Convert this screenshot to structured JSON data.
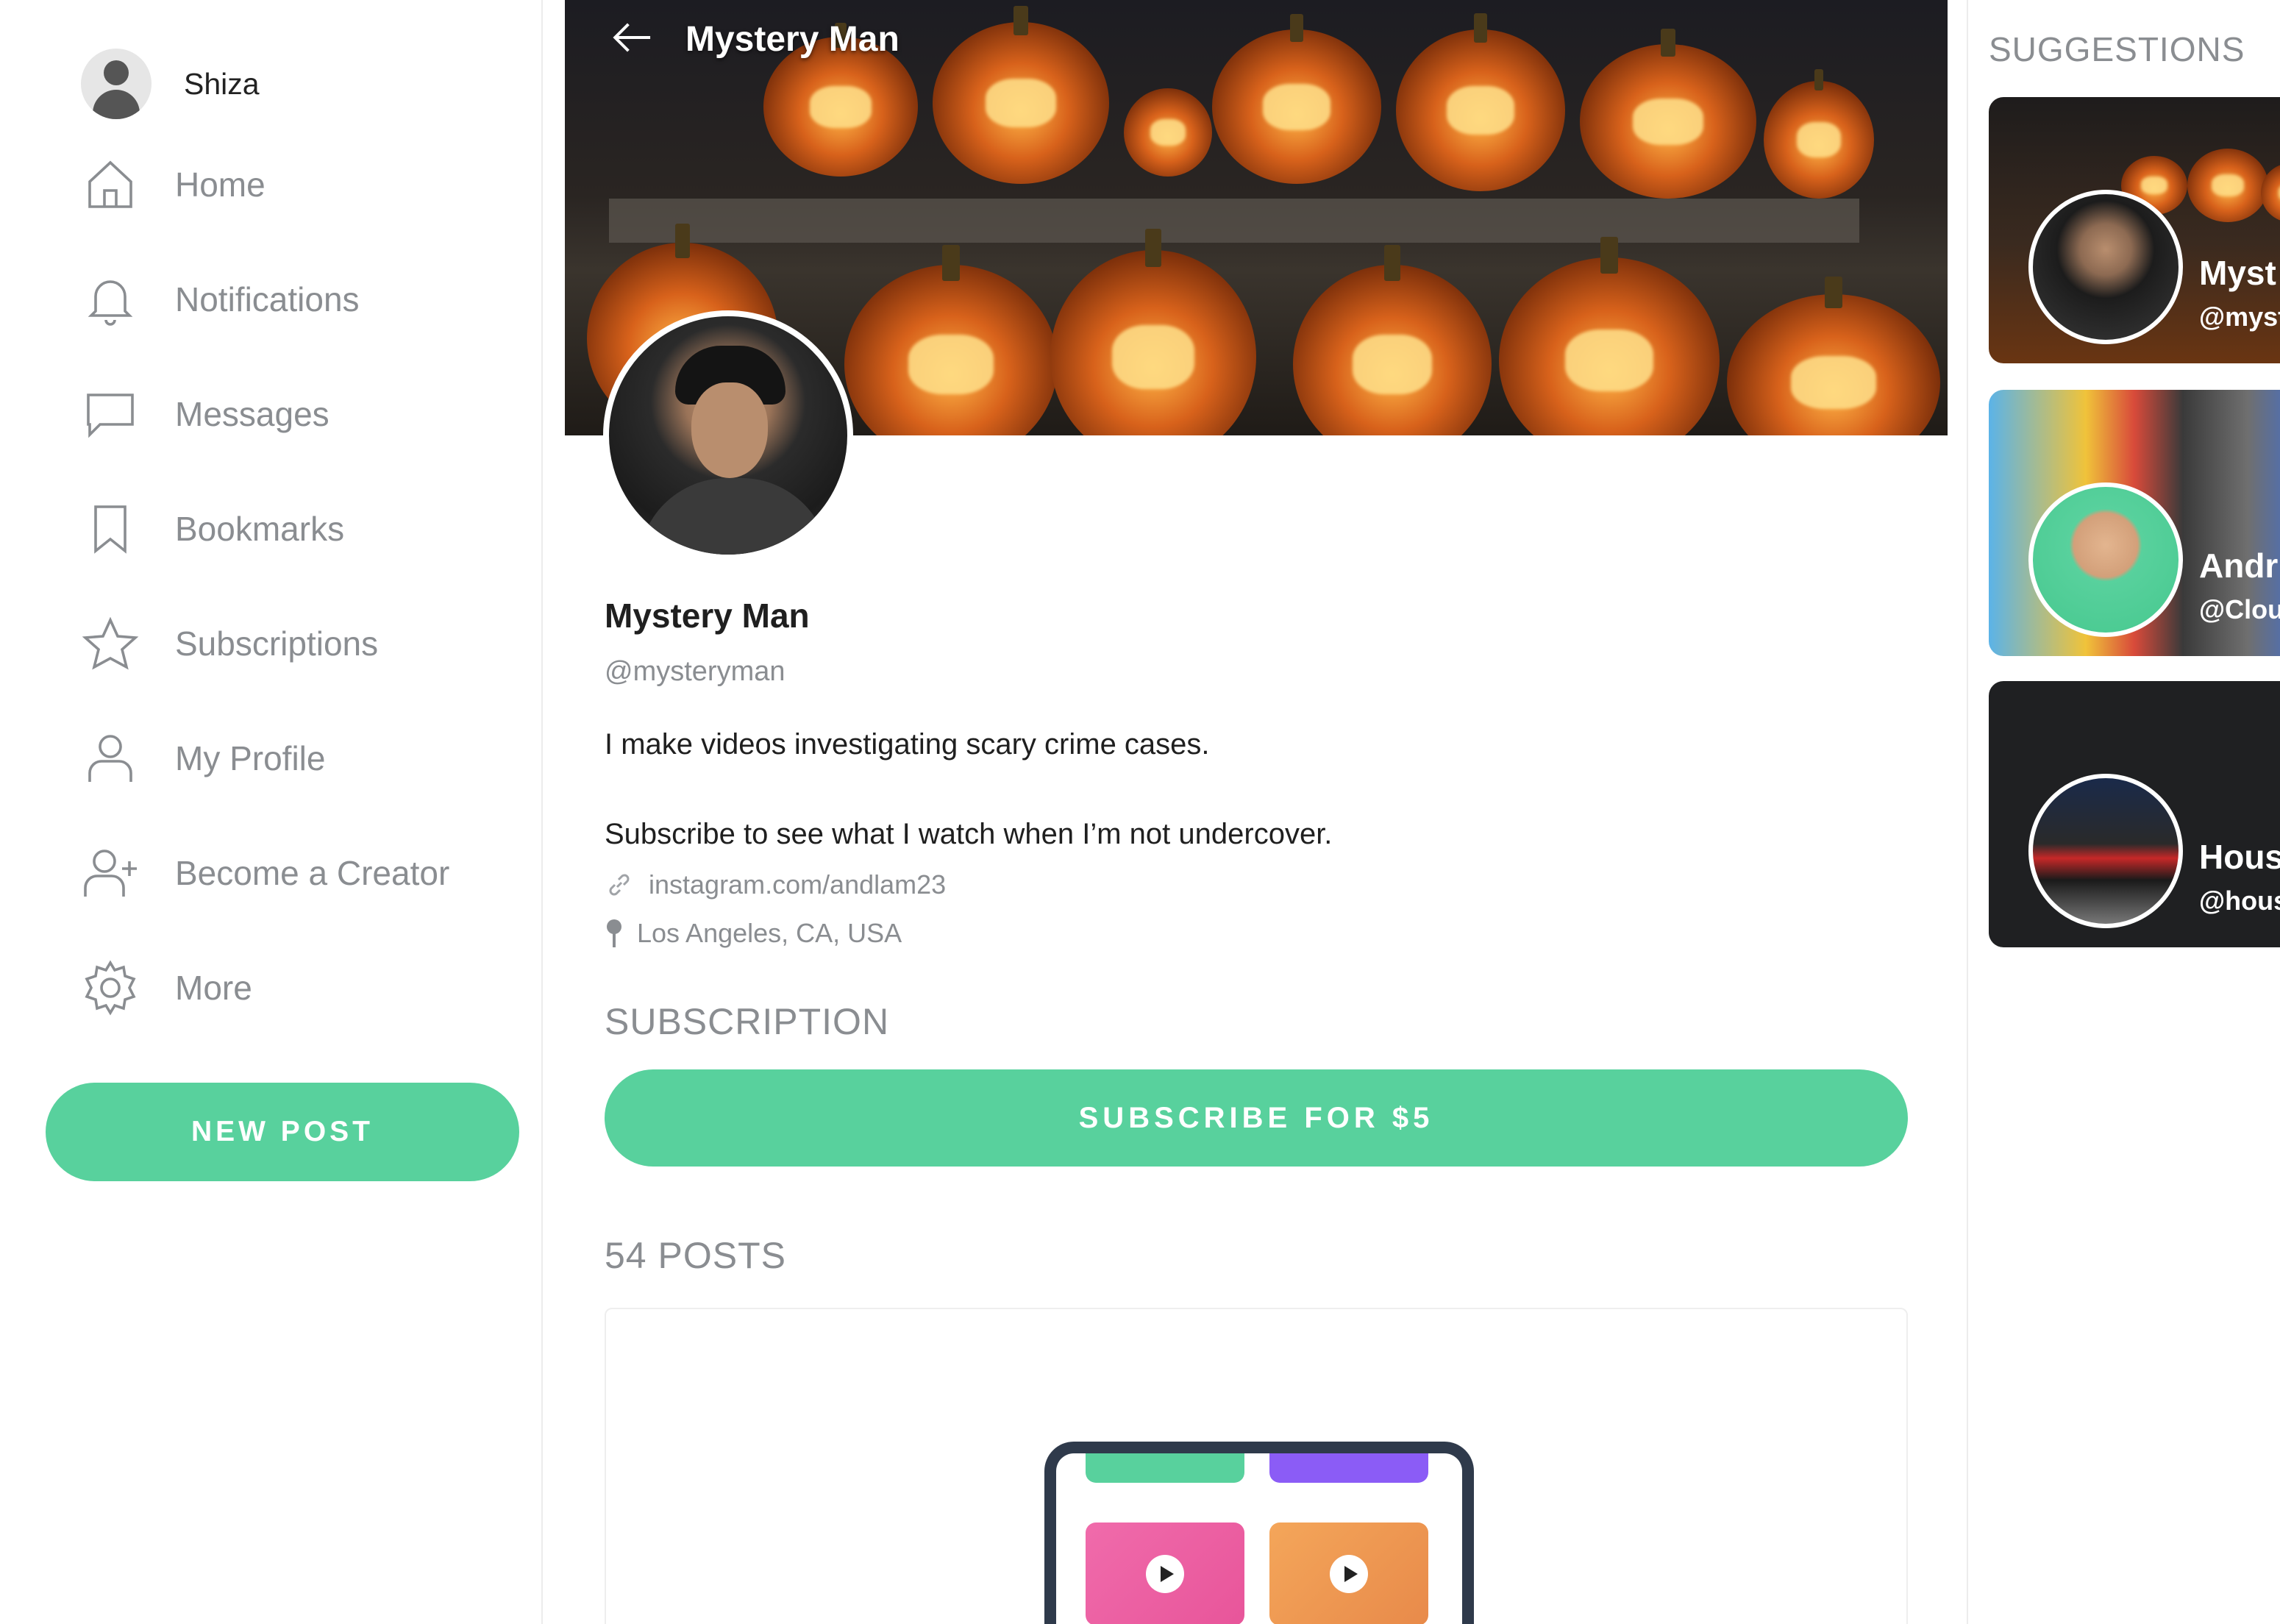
{
  "user": {
    "name": "Shiza"
  },
  "nav": [
    {
      "id": "home",
      "label": "Home",
      "icon": "home-icon"
    },
    {
      "id": "notifications",
      "label": "Notifications",
      "icon": "bell-icon"
    },
    {
      "id": "messages",
      "label": "Messages",
      "icon": "message-icon"
    },
    {
      "id": "bookmarks",
      "label": "Bookmarks",
      "icon": "bookmark-icon"
    },
    {
      "id": "subscriptions",
      "label": "Subscriptions",
      "icon": "star-icon"
    },
    {
      "id": "my-profile",
      "label": "My Profile",
      "icon": "user-icon"
    },
    {
      "id": "become-creator",
      "label": "Become a Creator",
      "icon": "user-plus-icon"
    },
    {
      "id": "more",
      "label": "More",
      "icon": "gear-icon"
    }
  ],
  "new_post_label": "NEW POST",
  "profile": {
    "header_title": "Mystery Man",
    "name": "Mystery Man",
    "handle": "@mysteryman",
    "bio_line1": "I make videos investigating scary crime cases.",
    "bio_line2": "Subscribe to see what I watch when I’m not undercover.",
    "link": "instagram.com/andlam23",
    "location": "Los Angeles, CA, USA"
  },
  "subscription": {
    "section_title": "SUBSCRIPTION",
    "button_label": "SUBSCRIBE FOR $5"
  },
  "posts": {
    "count_label": "54 POSTS"
  },
  "suggestions": {
    "title": "SUGGESTIONS",
    "items": [
      {
        "name": "Myst",
        "handle": "@myst"
      },
      {
        "name": "Andr",
        "handle": "@Clou"
      },
      {
        "name": "Hous",
        "handle": "@hous"
      }
    ]
  },
  "colors": {
    "accent": "#58d19d",
    "muted_text": "#8a8d91",
    "dark_card": "#1f2022"
  }
}
